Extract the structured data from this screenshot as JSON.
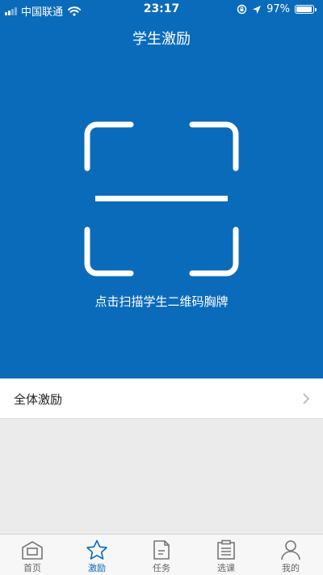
{
  "status_bar": {
    "carrier": "中国联通",
    "time": "23:17",
    "battery_percent": "97%",
    "battery_level": 0.97,
    "signal_bars_active": 2,
    "icons": [
      "signal-icon",
      "wifi-icon",
      "rotation-lock-icon",
      "location-arrow-icon",
      "battery-icon"
    ]
  },
  "header": {
    "title": "学生激励"
  },
  "scanner": {
    "hint": "点击扫描学生二维码胸牌",
    "icon": "qr-scan-frame-icon"
  },
  "list": {
    "items": [
      {
        "label": "全体激励",
        "icon": "chevron-right-icon"
      }
    ]
  },
  "tabbar": {
    "active": "激励",
    "tabs": [
      {
        "label": "首页",
        "icon": "home-icon"
      },
      {
        "label": "激励",
        "icon": "star-icon"
      },
      {
        "label": "任务",
        "icon": "document-icon"
      },
      {
        "label": "选课",
        "icon": "clipboard-icon"
      },
      {
        "label": "我的",
        "icon": "user-icon"
      }
    ]
  },
  "colors": {
    "primary": "#0b6bbb",
    "background": "#ebebeb",
    "tab_inactive": "#666666"
  }
}
